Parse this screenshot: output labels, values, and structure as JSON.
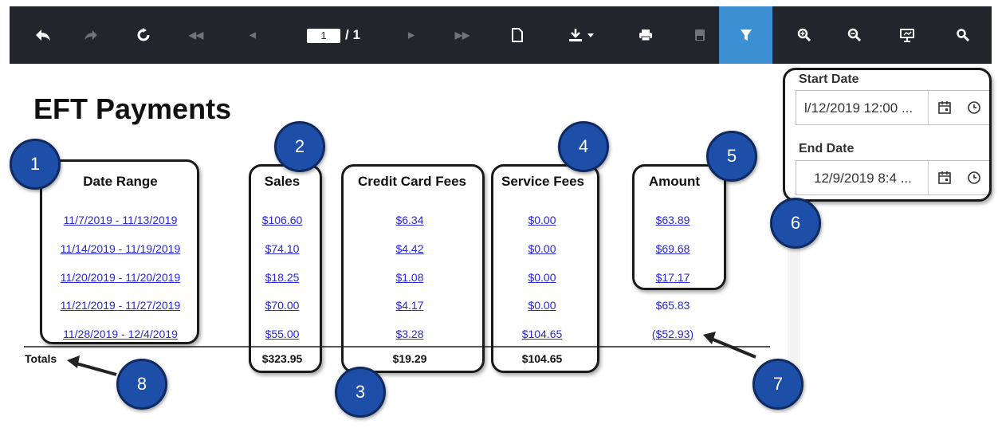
{
  "toolbar": {
    "page_current": "1",
    "page_total": "/ 1",
    "icons": [
      "back-icon",
      "forward-icon",
      "refresh-icon",
      "first-page-icon",
      "previous-page-icon",
      "next-page-icon",
      "last-page-icon",
      "document-icon",
      "download-icon",
      "print-icon",
      "save-icon",
      "filter-icon",
      "zoom-in-icon",
      "zoom-out-icon",
      "presentation-icon",
      "search-icon"
    ],
    "accent": "#3c8fd2",
    "background": "#22252b"
  },
  "report": {
    "title": "EFT Payments",
    "columns": [
      "Date Range",
      "Sales",
      "Credit Card Fees",
      "Service Fees",
      "Amount"
    ],
    "rows": [
      {
        "date_range": "11/7/2019 - 11/13/2019",
        "sales": "$106.60",
        "cc_fees": "$6.34",
        "service_fees": "$0.00",
        "amount": "$63.89"
      },
      {
        "date_range": "11/14/2019 - 11/19/2019",
        "sales": "$74.10",
        "cc_fees": "$4.42",
        "service_fees": "$0.00",
        "amount": "$69.68"
      },
      {
        "date_range": "11/20/2019 - 11/20/2019",
        "sales": "$18.25",
        "cc_fees": "$1.08",
        "service_fees": "$0.00",
        "amount": "$17.17"
      },
      {
        "date_range": "11/21/2019 - 11/27/2019",
        "sales": "$70.00",
        "cc_fees": "$4.17",
        "service_fees": "$0.00",
        "amount": "$65.83"
      },
      {
        "date_range": "11/28/2019 - 12/4/2019",
        "sales": "$55.00",
        "cc_fees": "$3.28",
        "service_fees": "$104.65",
        "amount": "($52.93)"
      }
    ],
    "totals": {
      "label": "Totals",
      "sales": "$323.95",
      "cc_fees": "$19.29",
      "service_fees": "$104.65"
    }
  },
  "params": {
    "start_label": "Start Date",
    "start_value": "l/12/2019 12:00 ...",
    "end_label": "End Date",
    "end_value": "12/9/2019 8:4 ..."
  },
  "badges": [
    "1",
    "2",
    "3",
    "4",
    "5",
    "6",
    "7",
    "8"
  ],
  "annotation_color": "#1d4fa8"
}
